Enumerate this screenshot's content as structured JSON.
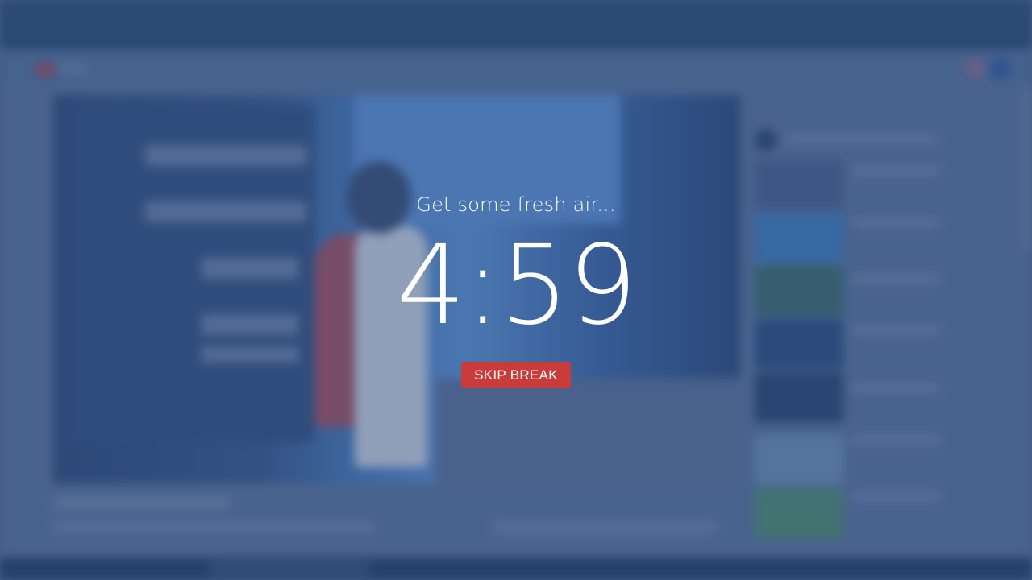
{
  "break_overlay": {
    "message": "Get some fresh air...",
    "countdown": "4:59",
    "skip_button_label": "SKIP BREAK"
  },
  "colors": {
    "overlay_tint": "#284878",
    "skip_button": "#c93c3a",
    "text": "#ffffff"
  }
}
